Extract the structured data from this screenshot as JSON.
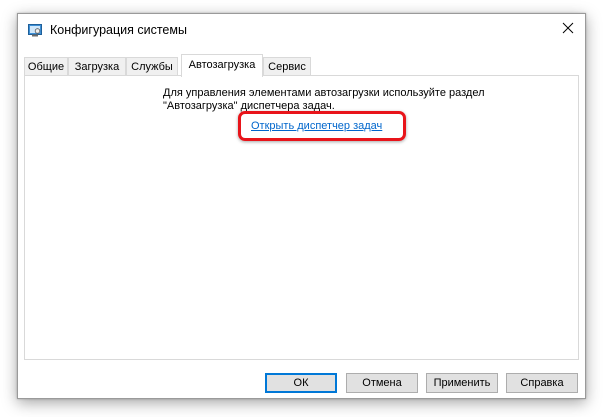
{
  "window": {
    "title": "Конфигурация системы",
    "icon": "msconfig-app-icon",
    "close_icon": "close-icon"
  },
  "tabs": [
    {
      "label": "Общие",
      "active": false
    },
    {
      "label": "Загрузка",
      "active": false
    },
    {
      "label": "Службы",
      "active": false
    },
    {
      "label": "Автозагрузка",
      "active": true
    },
    {
      "label": "Сервис",
      "active": false
    }
  ],
  "startup_panel": {
    "message_line1": "Для управления элементами автозагрузки используйте раздел",
    "message_line2": "\"Автозагрузка\" диспетчера задач.",
    "link_text": "Открыть диспетчер задач"
  },
  "buttons": {
    "ok": "ОК",
    "cancel": "Отмена",
    "apply": "Применить",
    "help": "Справка"
  },
  "colors": {
    "link": "#0066cc",
    "highlight": "#e8141a",
    "default_button_border": "#0078d7"
  }
}
